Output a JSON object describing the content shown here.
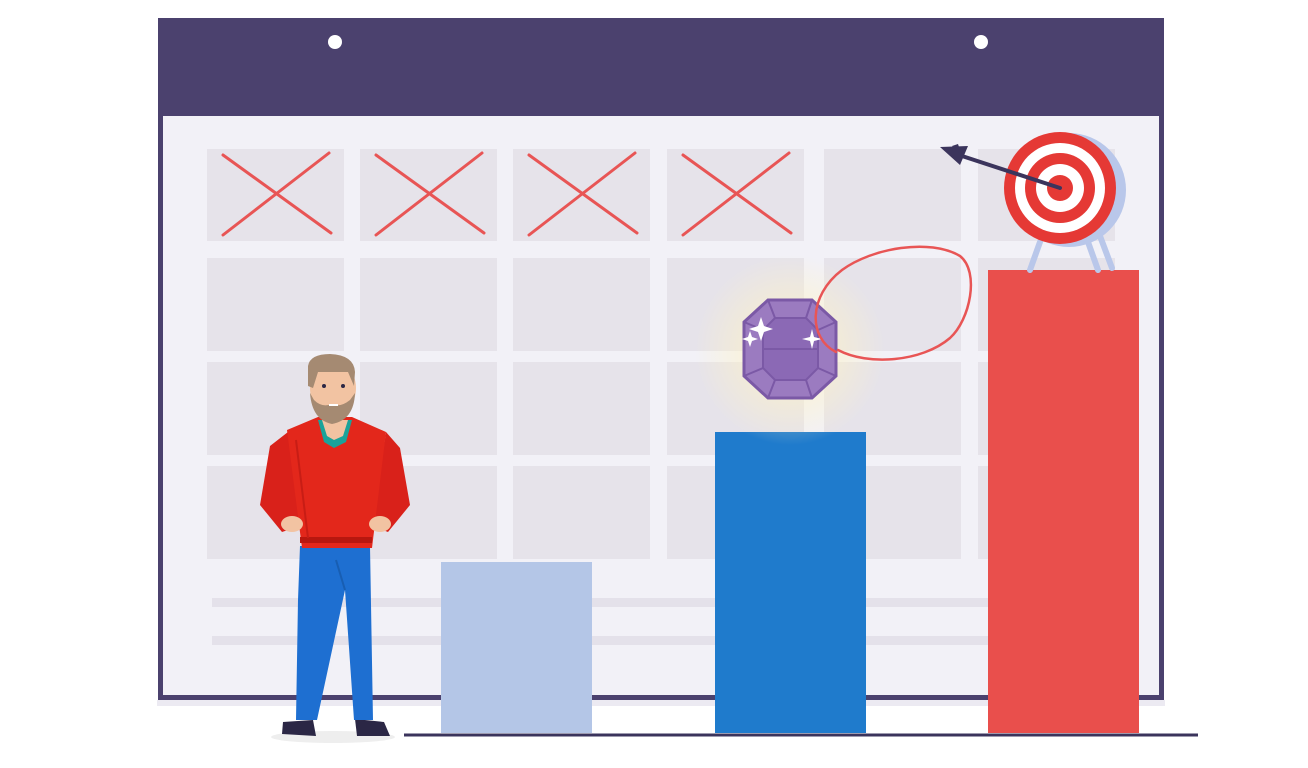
{
  "illustration": {
    "calendar": {
      "header_color": "#4b416e",
      "body_color": "#f2f1f7",
      "cell_color": "#e6e3ea",
      "crossed_out_days": 4,
      "cross_color": "#e85555"
    },
    "bars": [
      {
        "level": 0.37,
        "color": "#b4c6e7"
      },
      {
        "level": 0.65,
        "color": "#1f7bcc"
      },
      {
        "level": 1.0,
        "color": "#e94f4c"
      }
    ],
    "icons": [
      "gem-icon",
      "target-icon",
      "arrow-icon",
      "circle-annotation-icon"
    ],
    "colors": {
      "gem": "#9b7bc0",
      "target_red": "#e53935",
      "target_back": "#b9c7ea",
      "hoodie": "#e3271b",
      "jeans": "#1e6fd1",
      "hair": "#a58a72",
      "skin": "#f2c3a2",
      "baseline": "#3b345c"
    }
  }
}
